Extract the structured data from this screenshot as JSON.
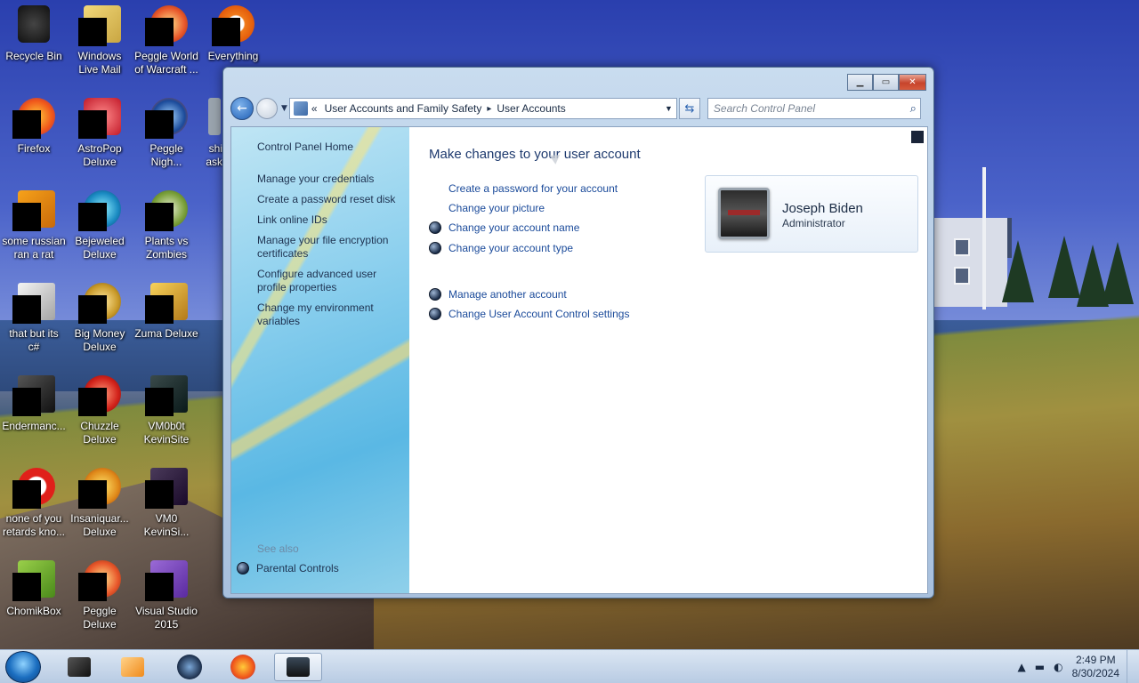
{
  "desktop": {
    "icons": [
      {
        "label": "Recycle Bin",
        "name": "recycle-bin"
      },
      {
        "label": "Windows\nLive Mail",
        "name": "windows-live-mail"
      },
      {
        "label": "Peggle World\nof Warcraft ...",
        "name": "peggle-world-of-warcraft"
      },
      {
        "label": "Everything",
        "name": "everything"
      },
      {
        "label": "Firefox",
        "name": "firefox"
      },
      {
        "label": "AstroPop\nDeluxe",
        "name": "astropop-deluxe"
      },
      {
        "label": "Peggle\nNigh...",
        "name": "peggle-nights"
      },
      {
        "label": "shi\nask",
        "name": "shi-ask"
      },
      {
        "label": "some russian\nran a rat",
        "name": "some-russian-ran-a-rat"
      },
      {
        "label": "Bejeweled\nDeluxe",
        "name": "bejeweled-deluxe"
      },
      {
        "label": "Plants vs\nZombies",
        "name": "plants-vs-zombies"
      },
      {
        "label": "that but its\nc#",
        "name": "that-but-its-csharp"
      },
      {
        "label": "Big Money\nDeluxe",
        "name": "big-money-deluxe"
      },
      {
        "label": "Zuma Deluxe",
        "name": "zuma-deluxe"
      },
      {
        "label": "Endermanc...",
        "name": "endermanch"
      },
      {
        "label": "Chuzzle\nDeluxe",
        "name": "chuzzle-deluxe"
      },
      {
        "label": "VM0b0t\nKevinSite",
        "name": "vm0b0t-kevinsite"
      },
      {
        "label": "none of you\nretards kno...",
        "name": "none-of-you"
      },
      {
        "label": "Insaniquar...\nDeluxe",
        "name": "insaniquarium-deluxe"
      },
      {
        "label": "VM0\nKevinSi...",
        "name": "vm0-kevinsite"
      },
      {
        "label": "ChomikBox",
        "name": "chomikbox"
      },
      {
        "label": "Peggle\nDeluxe",
        "name": "peggle-deluxe"
      },
      {
        "label": "Visual Studio\n2015",
        "name": "visual-studio-2015"
      }
    ]
  },
  "window": {
    "address": {
      "chevron": "«",
      "crumb1": "User Accounts and Family Safety",
      "crumb_sep": "▸",
      "crumb2": "User Accounts"
    },
    "search_placeholder": "Search Control Panel",
    "sidebar": {
      "home": "Control Panel Home",
      "links": [
        "Manage your credentials",
        "Create a password reset disk",
        "Link online IDs",
        "Manage your file encryption certificates",
        "Configure advanced user profile properties",
        "Change my environment variables"
      ],
      "see_also": "See also",
      "parental": "Parental Controls"
    },
    "main": {
      "title": "Make changes to your user account",
      "tasks": [
        "Create a password for your account",
        "Change your picture",
        "Change your account name",
        "Change your account type",
        "Manage another account",
        "Change User Account Control settings"
      ]
    },
    "user": {
      "name": "Joseph Biden",
      "role": "Administrator"
    }
  },
  "taskbar": {
    "time": "2:49 PM",
    "date": "8/30/2024"
  }
}
